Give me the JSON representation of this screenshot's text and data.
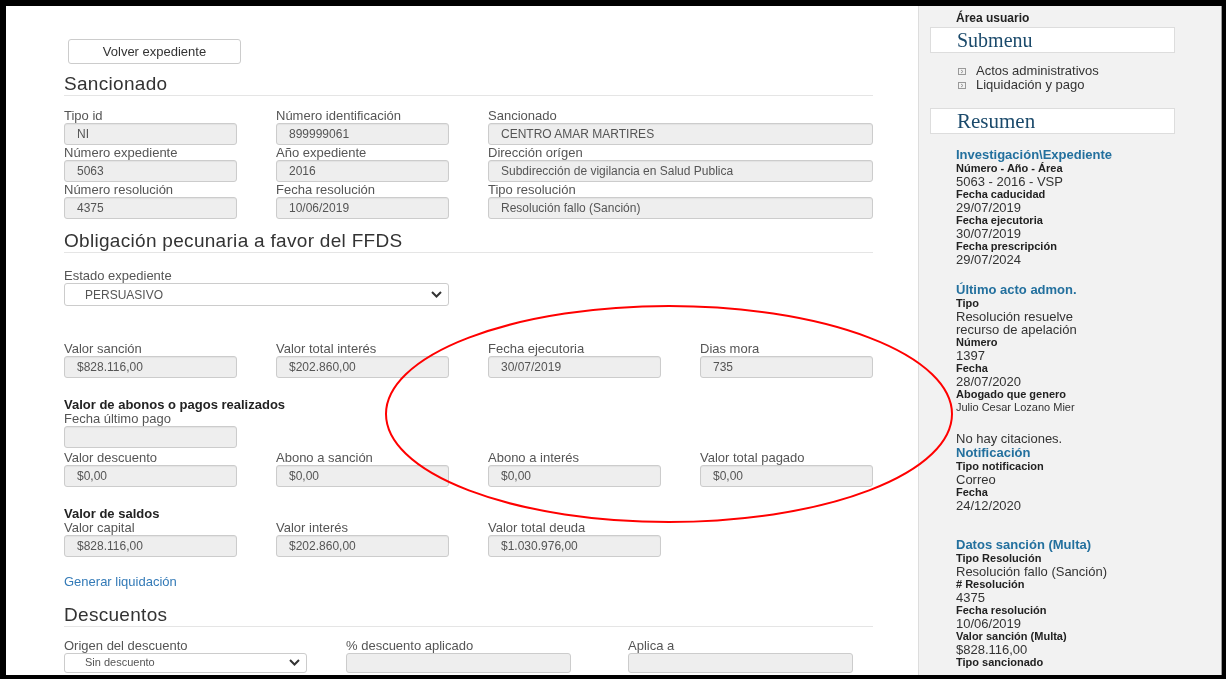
{
  "back_button": "Volver expediente",
  "sancionado": {
    "title": "Sancionado",
    "rows": [
      [
        {
          "label": "Tipo id",
          "value": "NI"
        },
        {
          "label": "Número identificación",
          "value": "899999061"
        },
        {
          "label": "Sancionado",
          "value": "CENTRO AMAR MARTIRES"
        }
      ],
      [
        {
          "label": "Número expediente",
          "value": "5063"
        },
        {
          "label": "Año expediente",
          "value": "2016"
        },
        {
          "label": "Dirección orígen",
          "value": "Subdirección de vigilancia en Salud Publica"
        }
      ],
      [
        {
          "label": "Número resolución",
          "value": "4375"
        },
        {
          "label": "Fecha resolución",
          "value": "10/06/2019"
        },
        {
          "label": "Tipo resolución",
          "value": "Resolución fallo (Sanción)"
        }
      ]
    ]
  },
  "obligacion": {
    "title": "Obligación pecunaria a favor del FFDS",
    "estado": {
      "label": "Estado expediente",
      "value": "PERSUASIVO"
    },
    "groups": [
      {
        "rows": [
          [
            {
              "label": "Valor sanción",
              "value": "$828.116,00"
            },
            {
              "label": "Valor total interés",
              "value": "$202.860,00"
            },
            {
              "label": "Fecha ejecutoria",
              "value": "30/07/2019"
            },
            {
              "label": "Dias mora",
              "value": "735"
            }
          ]
        ]
      },
      {
        "heading": "Valor de abonos o pagos realizados",
        "rows": [
          [
            {
              "label": "Fecha último pago"
            }
          ],
          [
            {
              "label": "Valor descuento",
              "value": "$0,00"
            },
            {
              "label": "Abono a sanción",
              "value": "$0,00"
            },
            {
              "label": "Abono a interés",
              "value": "$0,00"
            },
            {
              "label": "Valor total pagado",
              "value": "$0,00"
            }
          ]
        ]
      },
      {
        "heading": "Valor de saldos",
        "rows": [
          [
            {
              "label": "Valor capital",
              "value": "$828.116,00"
            },
            {
              "label": "Valor interés",
              "value": "$202.860,00"
            },
            {
              "label": "Valor total deuda",
              "value": "$1.030.976,00"
            }
          ]
        ]
      }
    ],
    "link": "Generar liquidación"
  },
  "descuentos": {
    "title": "Descuentos",
    "fields": [
      {
        "kind": "select",
        "label": "Origen del descuento",
        "value": "Sin descuento"
      },
      {
        "kind": "input",
        "label": "% descuento aplicado"
      },
      {
        "kind": "input",
        "label": "Aplica a"
      }
    ]
  },
  "sidebar": {
    "user_area": "Área usuario",
    "submenu": {
      "title": "Submenu",
      "items": [
        "Actos administrativos",
        "Liquidación y pago"
      ]
    },
    "resumen": {
      "title": "Resumen",
      "sections": [
        {
          "heading": "Investigación\\Expediente",
          "entries": [
            {
              "label": "Número - Año - Área",
              "value": "5063 - 2016 - VSP"
            },
            {
              "label": "Fecha caducidad",
              "value": "29/07/2019"
            },
            {
              "label": "Fecha ejecutoria",
              "value": "30/07/2019"
            },
            {
              "label": "Fecha prescripción",
              "value": "29/07/2024"
            }
          ]
        },
        {
          "heading": "Último acto admon.",
          "entries": [
            {
              "label": "Tipo",
              "value": "Resolución resuelve recurso de apelación"
            },
            {
              "label": "Número",
              "value": "1397"
            },
            {
              "label": "Fecha",
              "value": "28/07/2020"
            },
            {
              "label": "Abogado que genero",
              "value": "Julio Cesar Lozano Mier",
              "kind": "compact"
            }
          ]
        },
        {
          "note": "No hay citaciones.",
          "heading": "Notificación",
          "entries": [
            {
              "label": "Tipo notificacion",
              "value": "Correo"
            },
            {
              "label": "Fecha",
              "value": "24/12/2020"
            }
          ]
        },
        {
          "heading": "Datos sanción (Multa)",
          "entries": [
            {
              "label": "Tipo Resolución",
              "value": "Resolución fallo (Sanción)"
            },
            {
              "label": "# Resolución",
              "value": "4375"
            },
            {
              "label": "Fecha resolución",
              "value": "10/06/2019"
            },
            {
              "label": "Valor sanción (Multa)",
              "value": "$828.116,00"
            },
            {
              "label": "Tipo sancionado"
            }
          ]
        }
      ]
    }
  }
}
